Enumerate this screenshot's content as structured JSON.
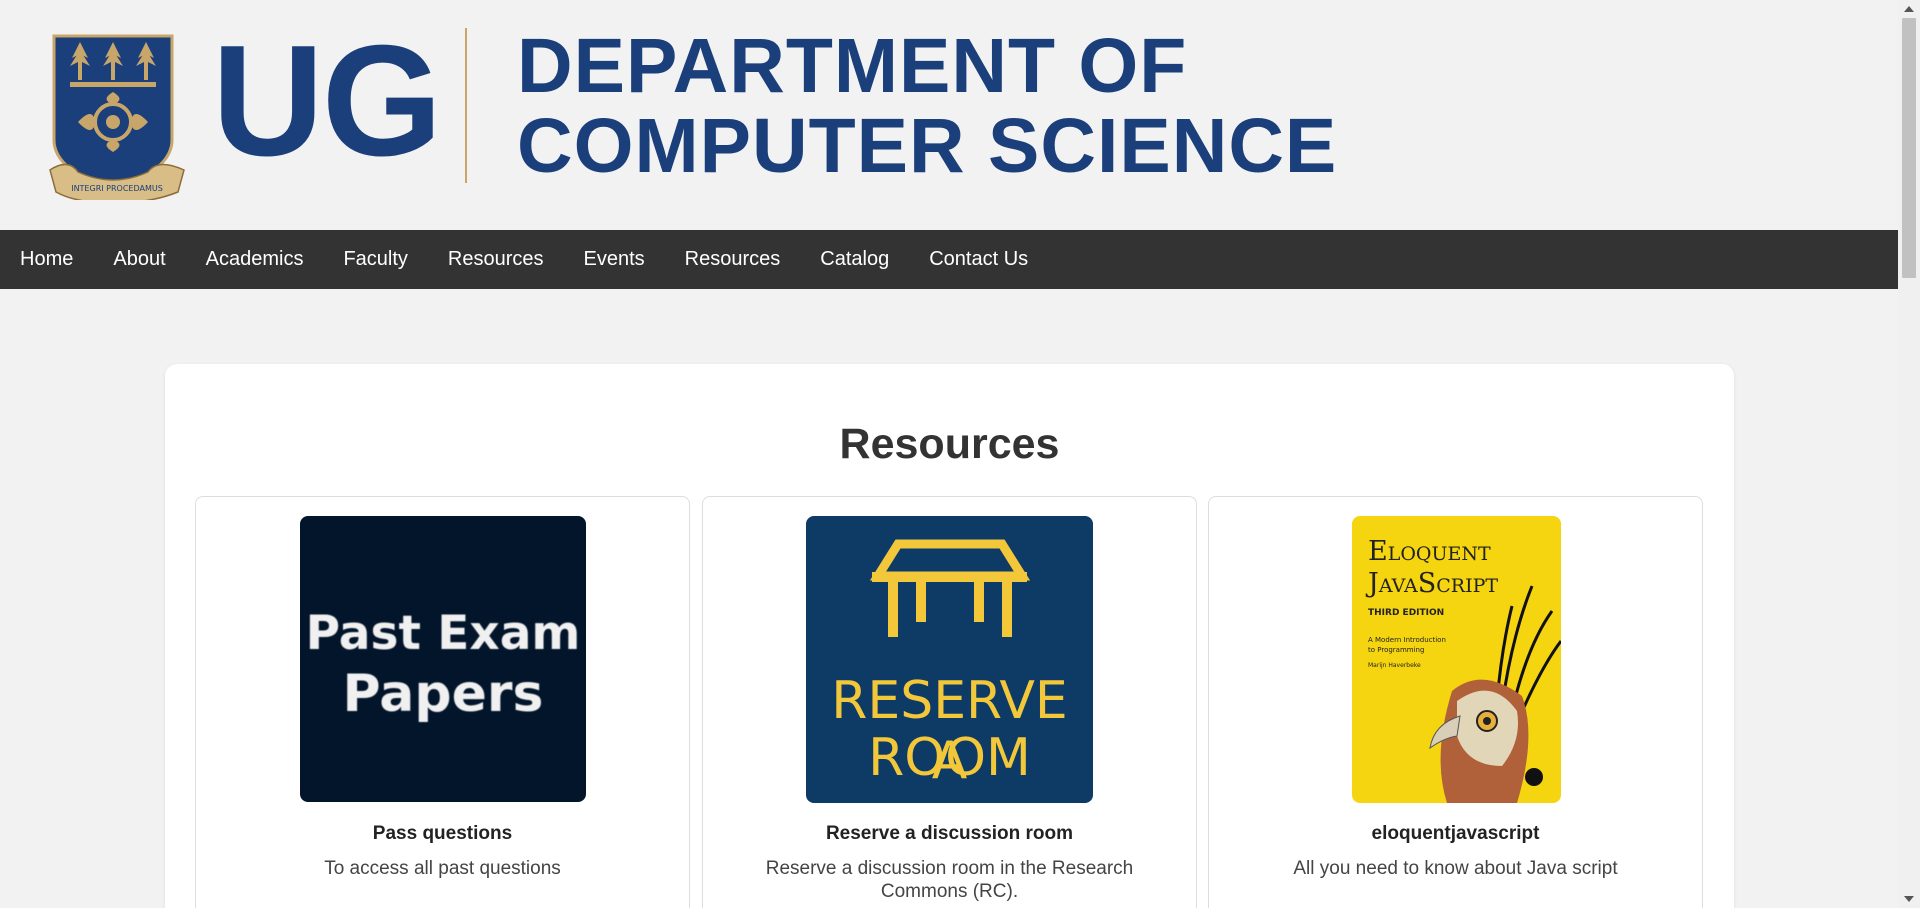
{
  "header": {
    "logo_text": "UG",
    "department_line1": "DEPARTMENT OF",
    "department_line2": "COMPUTER SCIENCE",
    "crest_motto": "INTEGRI PROCEDAMUS"
  },
  "nav": {
    "items": [
      {
        "label": "Home"
      },
      {
        "label": "About"
      },
      {
        "label": "Academics"
      },
      {
        "label": "Faculty"
      },
      {
        "label": "Resources"
      },
      {
        "label": "Events"
      },
      {
        "label": "Resources"
      },
      {
        "label": "Catalog"
      },
      {
        "label": "Contact Us"
      }
    ]
  },
  "main": {
    "title": "Resources",
    "cards": [
      {
        "title": "Pass questions",
        "description": "To access all past questions",
        "image_line1": "Past Exam",
        "image_line2": "Papers"
      },
      {
        "title": "Reserve a discussion room",
        "description": "Reserve a discussion room in the Research Commons (RC).",
        "image_line1": "RESERVE A",
        "image_line2": "ROOM"
      },
      {
        "title": "eloquentjavascript",
        "description": "All you need to know about Java script",
        "book_title_line1": "Eloquent",
        "book_title_line2": "JavaScript",
        "book_edition": "THIRD EDITION",
        "book_subtitle_line1": "A Modern Introduction",
        "book_subtitle_line2": "to Programming",
        "book_author": "Marijn Haverbeke"
      }
    ]
  },
  "colors": {
    "brand_blue": "#1b3f7a",
    "brand_gold": "#c8a66a",
    "nav_background": "#333333",
    "page_background": "#f2f2f2"
  }
}
